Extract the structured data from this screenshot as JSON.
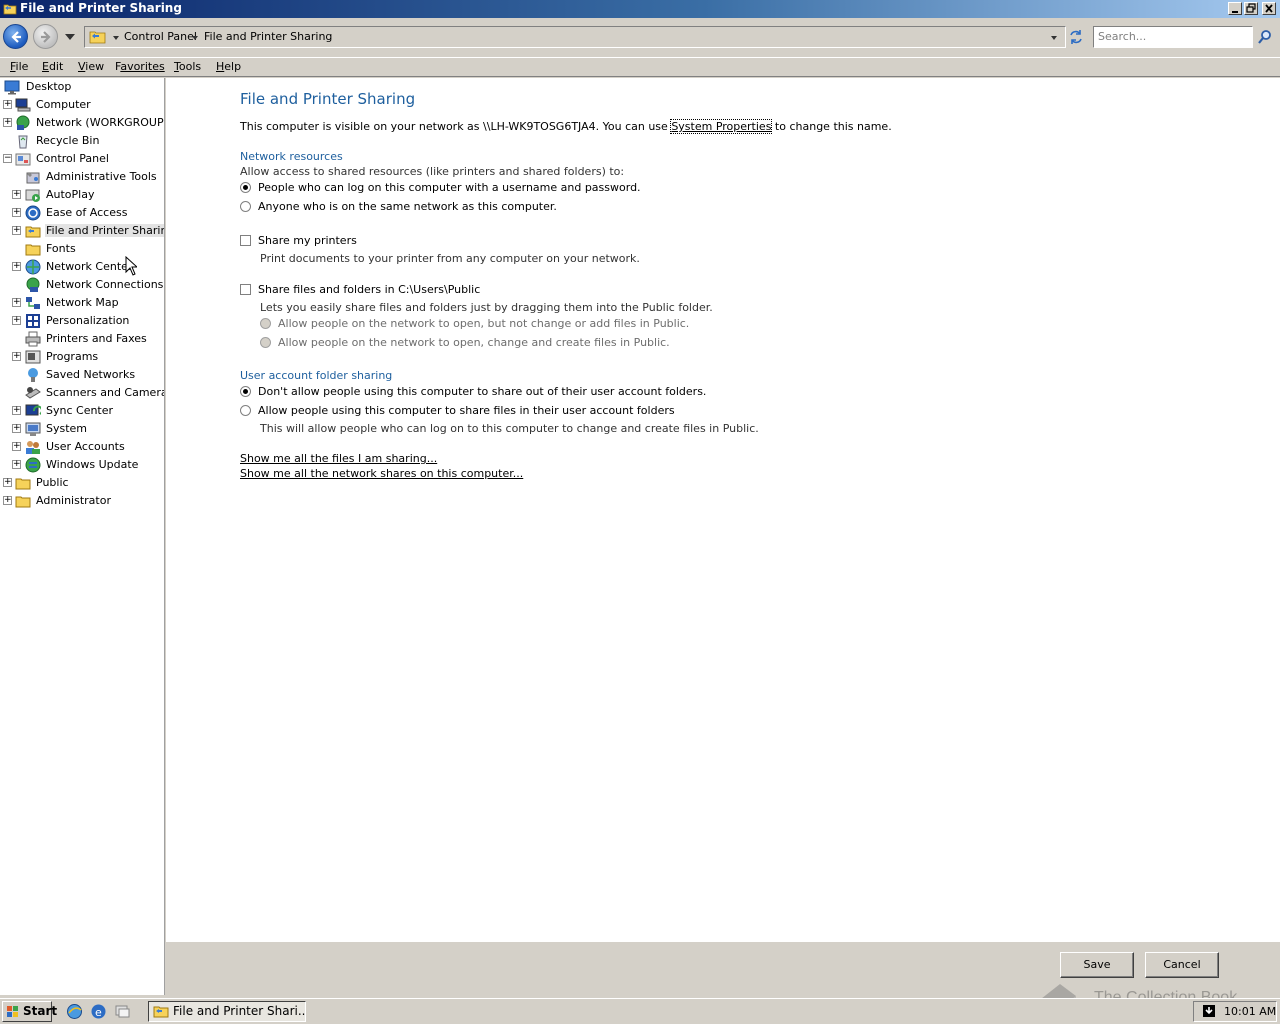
{
  "window": {
    "title": "File and Printer Sharing"
  },
  "address_bar": {
    "crumbs": [
      "Control Panel",
      "File and Printer Sharing"
    ],
    "search_placeholder": "Search..."
  },
  "menu": {
    "items": [
      {
        "key": "F",
        "rest": "ile"
      },
      {
        "key": "E",
        "rest": "dit"
      },
      {
        "key": "V",
        "rest": "iew"
      },
      {
        "key": "F",
        "rest": "avorites",
        "prefix": ""
      },
      {
        "key": "T",
        "rest": "ools"
      },
      {
        "key": "H",
        "rest": "elp"
      }
    ]
  },
  "tree": {
    "items": [
      {
        "label": "Desktop",
        "icon": "desktop-icon"
      },
      {
        "label": "Computer",
        "icon": "computer-icon"
      },
      {
        "label": "Network (WORKGROUP)",
        "icon": "network-icon"
      },
      {
        "label": "Recycle Bin",
        "icon": "recycle-bin-icon"
      },
      {
        "label": "Control Panel",
        "icon": "control-panel-icon"
      },
      {
        "label": "Administrative Tools",
        "icon": "admin-tools-icon"
      },
      {
        "label": "AutoPlay",
        "icon": "autoplay-icon"
      },
      {
        "label": "Ease of Access",
        "icon": "ease-of-access-icon"
      },
      {
        "label": "File and Printer Sharing",
        "icon": "folder-share-icon"
      },
      {
        "label": "Fonts",
        "icon": "fonts-folder-icon"
      },
      {
        "label": "Network Center",
        "icon": "network-center-icon"
      },
      {
        "label": "Network Connections",
        "icon": "network-connections-icon"
      },
      {
        "label": "Network Map",
        "icon": "network-map-icon"
      },
      {
        "label": "Personalization",
        "icon": "personalization-icon"
      },
      {
        "label": "Printers and Faxes",
        "icon": "printer-icon"
      },
      {
        "label": "Programs",
        "icon": "programs-icon"
      },
      {
        "label": "Saved Networks",
        "icon": "saved-networks-icon"
      },
      {
        "label": "Scanners and Cameras",
        "icon": "scanner-icon"
      },
      {
        "label": "Sync Center",
        "icon": "sync-center-icon"
      },
      {
        "label": "System",
        "icon": "system-icon"
      },
      {
        "label": "User Accounts",
        "icon": "user-accounts-icon"
      },
      {
        "label": "Windows Update",
        "icon": "windows-update-icon"
      },
      {
        "label": "Public",
        "icon": "folder-icon"
      },
      {
        "label": "Administrator",
        "icon": "folder-icon"
      }
    ]
  },
  "content": {
    "heading": "File and Printer Sharing",
    "visible_prefix": "This computer is visible on your network as \\\\LH-WK9TOSG6TJA4.  You can use",
    "system_properties_link": "System Properties",
    "visible_suffix": "to change this name.",
    "network_resources": {
      "title": "Network resources",
      "description": "Allow access to shared resources (like printers and shared folders) to:",
      "option_1": "People who can log on this computer with a username and password.",
      "option_2": "Anyone who is on the same network as this computer.",
      "selected": 1
    },
    "printers": {
      "label": "Share my printers",
      "description": "Print documents to your printer from any computer on your network.",
      "checked": false
    },
    "public_folder": {
      "label": "Share files and folders in C:\\Users\\Public",
      "description": "Lets you easily share files and folders just by dragging them into the Public folder.",
      "option_1": "Allow people on the network to open, but not change or add files in Public.",
      "option_2": "Allow people on the network to open, change and create files in Public.",
      "checked": false
    },
    "user_folders": {
      "title": "User account folder sharing",
      "option_1": "Don't allow people using this computer to share out of their user account folders.",
      "option_2": "Allow people using this computer to share files in their user account folders",
      "option_2_note": "This will allow people who can log on to this computer to change and create files in Public.",
      "selected": 1
    },
    "link_files": "Show me all the files I am sharing...",
    "link_shares": "Show me all the network shares on this computer..."
  },
  "footer": {
    "save_label": "Save",
    "cancel_label": "Cancel"
  },
  "watermark": "The Collection Book",
  "taskbar": {
    "start_label": "Start",
    "task_label": "File and Printer Shari...",
    "clock": "10:01 AM"
  },
  "colors": {
    "accent_heading": "#1e5f9e",
    "title_bar": "#0a246a",
    "chrome": "#d4d0c8"
  }
}
